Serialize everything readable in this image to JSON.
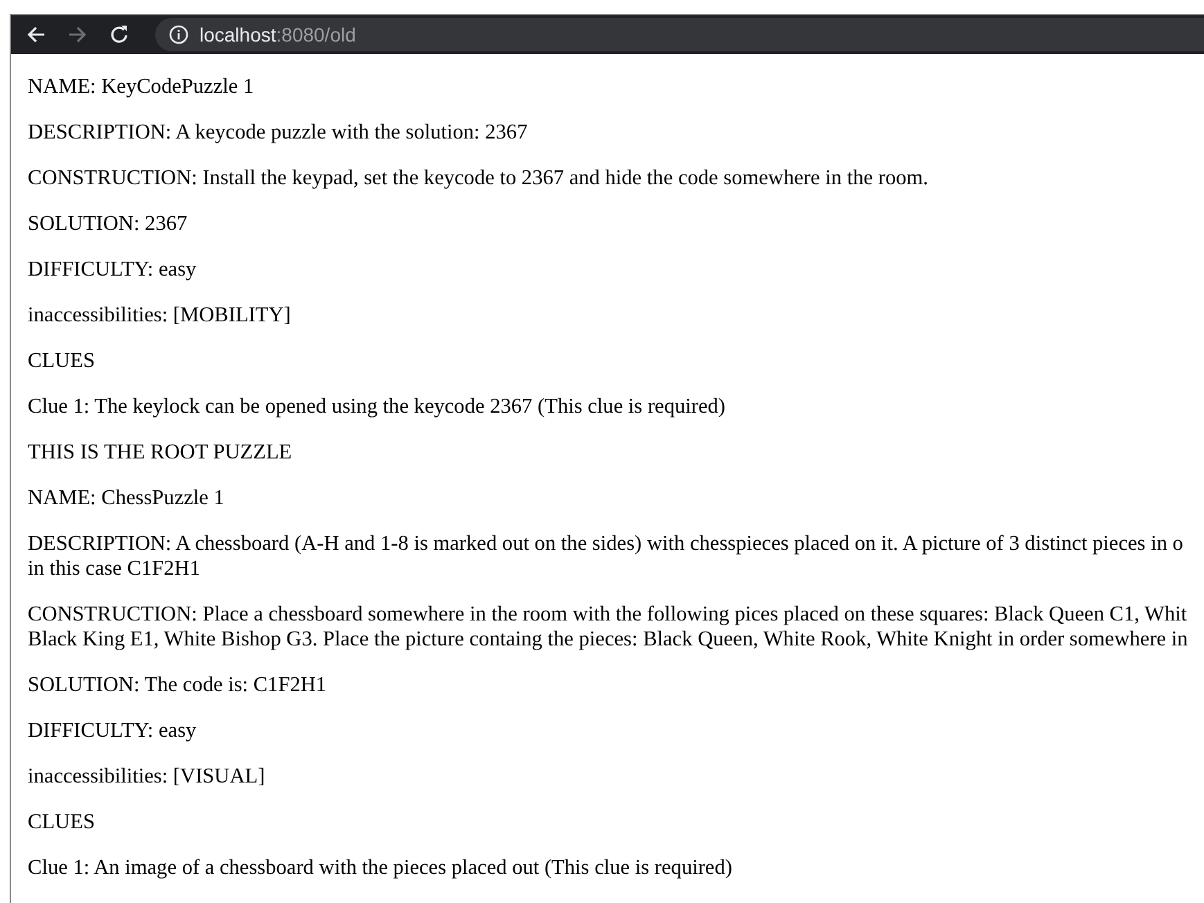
{
  "toolbar": {
    "url_host": "localhost",
    "url_path": ":8080/old"
  },
  "paragraphs": [
    [
      "NAME: KeyCodePuzzle 1"
    ],
    [
      "DESCRIPTION: A keycode puzzle with the solution: 2367"
    ],
    [
      "CONSTRUCTION: Install the keypad, set the keycode to 2367 and hide the code somewhere in the room."
    ],
    [
      "SOLUTION: 2367"
    ],
    [
      "DIFFICULTY: easy"
    ],
    [
      "inaccessibilities: [MOBILITY]"
    ],
    [
      "CLUES"
    ],
    [
      "Clue 1: The keylock can be opened using the keycode 2367 (This clue is required)"
    ],
    [
      "THIS IS THE ROOT PUZZLE"
    ],
    [
      "NAME: ChessPuzzle 1"
    ],
    [
      "DESCRIPTION: A chessboard (A-H and 1-8 is marked out on the sides) with chesspieces placed on it. A picture of 3 distinct pieces in o",
      "in this case C1F2H1"
    ],
    [
      "CONSTRUCTION: Place a chessboard somewhere in the room with the following pices placed on these squares: Black Queen C1, Whit",
      "Black King E1, White Bishop G3. Place the picture containg the pieces: Black Queen, White Rook, White Knight in order somewhere in"
    ],
    [
      "SOLUTION: The code is: C1F2H1"
    ],
    [
      "DIFFICULTY: easy"
    ],
    [
      "inaccessibilities: [VISUAL]"
    ],
    [
      "CLUES"
    ],
    [
      "Clue 1: An image of a chessboard with the pieces placed out (This clue is required)"
    ]
  ]
}
